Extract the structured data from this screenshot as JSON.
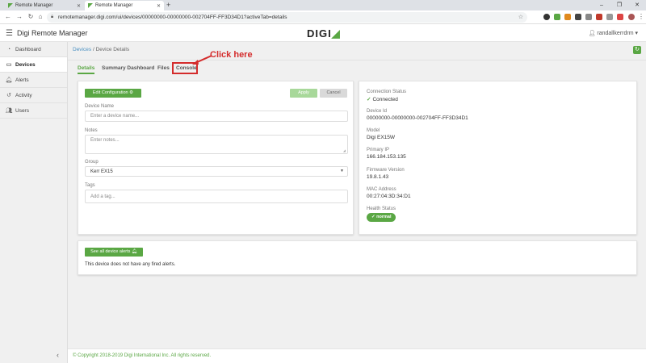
{
  "browser": {
    "tabs": [
      {
        "title": "Remote Manager"
      },
      {
        "title": "Remote Manager"
      }
    ],
    "newtab_label": "+",
    "url": "remotemanager.digi.com/ui/devices/00000000-00000000-002704FF-FF3D34D1?activeTab=details"
  },
  "header": {
    "app_title": "Digi Remote Manager",
    "logo_text": "DIGI",
    "user": "randallkerrdrm"
  },
  "sidebar": {
    "items": [
      {
        "label": "Dashboard",
        "icon": "dashboard-icon"
      },
      {
        "label": "Devices",
        "icon": "devices-icon"
      },
      {
        "label": "Alerts",
        "icon": "bell-icon"
      },
      {
        "label": "Activity",
        "icon": "history-icon"
      },
      {
        "label": "Users",
        "icon": "users-icon"
      }
    ]
  },
  "breadcrumb": {
    "root": "Devices",
    "separator": "/",
    "current": "Device Details"
  },
  "subtabs": [
    "Details",
    "Summary Dashboard",
    "Files",
    "Console"
  ],
  "annotation": {
    "callout": "Click here"
  },
  "config": {
    "edit_button": "Edit Configuration",
    "apply_button": "Apply",
    "cancel_button": "Cancel",
    "device_name_label": "Device Name",
    "device_name_placeholder": "Enter a device name...",
    "notes_label": "Notes",
    "notes_placeholder": "Enter notes...",
    "group_label": "Group",
    "group_value": "Kerr EX15",
    "tags_label": "Tags",
    "tags_placeholder": "Add a tag..."
  },
  "info": {
    "connection_status_label": "Connection Status",
    "connection_status_value": "Connected",
    "device_id_label": "Device Id",
    "device_id_value": "00000000-00000000-002704FF-FF3D34D1",
    "model_label": "Model",
    "model_value": "Digi EX15W",
    "primary_ip_label": "Primary IP",
    "primary_ip_value": "166.184.153.135",
    "firmware_label": "Firmware Version",
    "firmware_value": "19.8.1.43",
    "mac_label": "MAC Address",
    "mac_value": "00:27:04:3D:34:D1",
    "health_label": "Health Status",
    "health_value": "normal"
  },
  "alerts": {
    "button": "See all device alerts",
    "message": "This device does not have any fired alerts."
  },
  "footer": {
    "copyright": "© Copyright 2018-2019 Digi International Inc. All rights reserved."
  },
  "colors": {
    "accent": "#5aa744",
    "annotation": "#d42c2c",
    "link": "#4a90c2"
  }
}
